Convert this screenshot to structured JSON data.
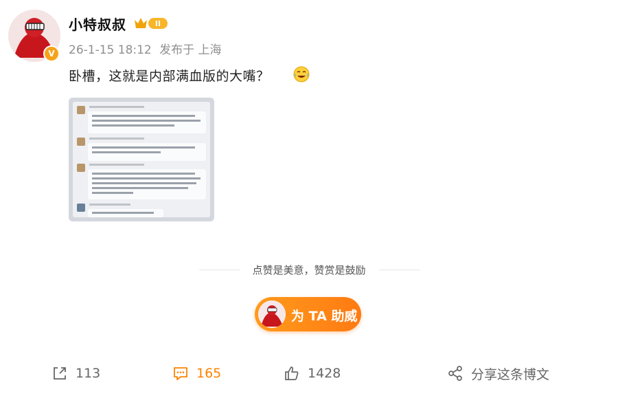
{
  "user": {
    "name": "小特叔叔",
    "vip_badge": "II",
    "verified_icon": "verified-badge-icon"
  },
  "post": {
    "date": "26-1-15 18:12",
    "source": "发布于 上海",
    "text": "卧槽，这就是内部满血版的大嘴？",
    "emoji": "laughing-crying-emoji-icon"
  },
  "reward": {
    "caption": "点赞是美意，赞赏是鼓励",
    "button_label": "为 TA 助威"
  },
  "actions": {
    "repost_count": "113",
    "comment_count": "165",
    "like_count": "1428",
    "share_label": "分享这条博文"
  },
  "colors": {
    "accent": "#ff8200",
    "button_gradient_start": "#ff9b1c",
    "button_gradient_end": "#ff7a12",
    "meta_text": "#8f8f8f"
  }
}
